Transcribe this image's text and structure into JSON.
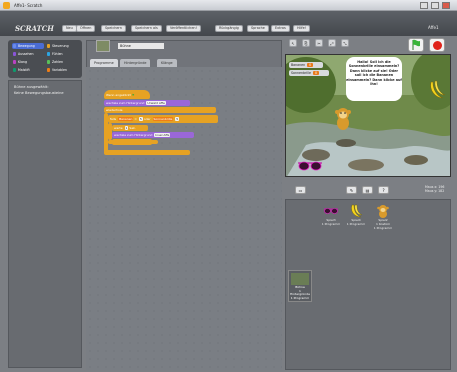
{
  "window": {
    "title": "Affe1- Scratch"
  },
  "brand": "SCRATCH",
  "menu": [
    "Neu",
    "Öffnen",
    "Speichern",
    "Speichern als",
    "Veröffentlichen!",
    "Rückgängig",
    "Sprache",
    "Extras",
    "Hilfe!"
  ],
  "user": "Affe1",
  "categories": [
    {
      "label": "Bewegung",
      "color": "#4a6cd4"
    },
    {
      "label": "Steuerung",
      "color": "#e6a223"
    },
    {
      "label": "Aussehen",
      "color": "#8a55d7"
    },
    {
      "label": "Fühlen",
      "color": "#2ca5e2"
    },
    {
      "label": "Klang",
      "color": "#bb42c3"
    },
    {
      "label": "Zahlen",
      "color": "#59c059"
    },
    {
      "label": "Malstift",
      "color": "#0e9a6c"
    },
    {
      "label": "Variablen",
      "color": "#ee7d16"
    }
  ],
  "block_panel": {
    "line1": "Bühne ausgewählt:",
    "line2": "Keine Bewegungsbausteine"
  },
  "sprite_name": "Bühne",
  "tabs": [
    "Programme",
    "Hintergründe",
    "Klänge"
  ],
  "scripts": {
    "hat": "Wenn angeklickt",
    "b1_text": "wechsle zum Hintergrund",
    "b1_slot": "Urwald Affe",
    "b2": "wiederhole",
    "b3_prefix": "falls",
    "b3_var1": "Bananen",
    "b3_eq": "=",
    "b3_v1": "5",
    "b3_or": "oder",
    "b3_var2": "Sonnenbrille",
    "b3_v2": "5",
    "b4_prefix": "warte",
    "b4_val": "1",
    "b4_unit": "Sek.",
    "b5_text": "wechsle zum Hintergrund",
    "b5_slot": "Insel Affe",
    "b6": "stoppe Programm"
  },
  "stage": {
    "bubble": "Hallo! Soll ich die Sonnenbrille einsammeln? Dann klicke auf sie! Oder soll ich die Bananen einsammeln? Dann klicke auf ihn!",
    "vars": [
      {
        "label": "Bananen",
        "value": "0"
      },
      {
        "label": "Sonnenbrille",
        "value": "0"
      }
    ]
  },
  "coords": {
    "x": "Maus x: 196",
    "y": "Maus y: 182"
  },
  "sprites": [
    {
      "name": "Spiel3",
      "info": "1 Programm"
    },
    {
      "name": "Spiel4",
      "info": "1 Programm"
    },
    {
      "name": "Spiel2",
      "info": "1 Kostüm\n1 Programm"
    }
  ],
  "stage_tile": {
    "name": "Bühne",
    "info": "1 Hintergründe\n1 Programm"
  }
}
